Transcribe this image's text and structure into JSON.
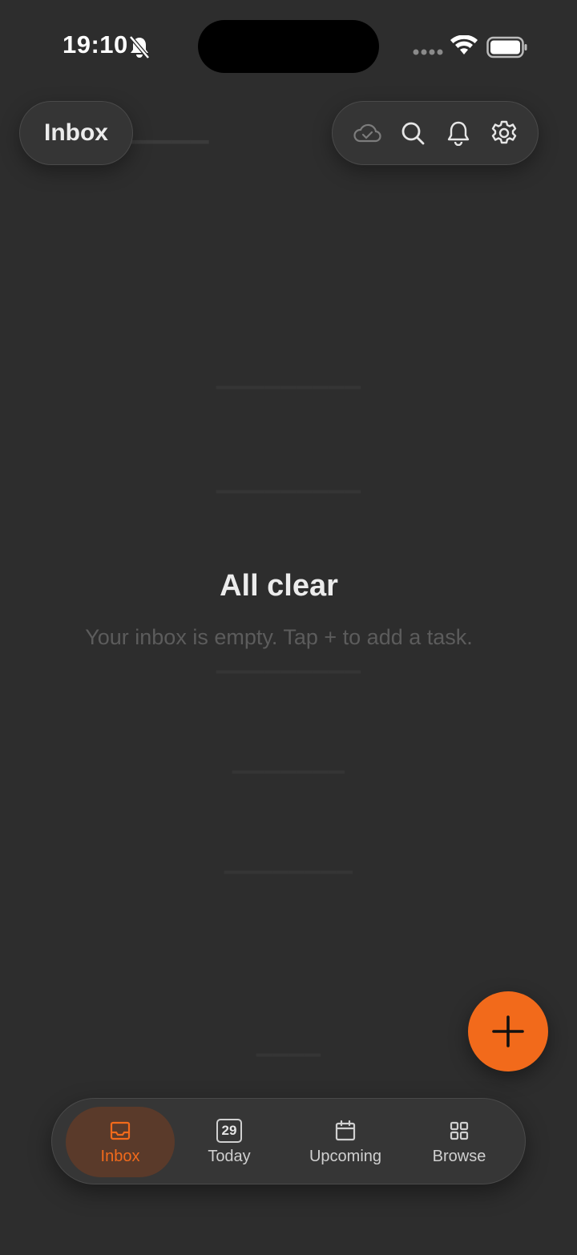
{
  "status_bar": {
    "time": "19:10",
    "icons": [
      "bell-slash-icon",
      "cellular-signal-icon",
      "wifi-icon",
      "battery-icon"
    ]
  },
  "header": {
    "title": "Inbox",
    "actions": [
      "cloud-sync-icon",
      "search-icon",
      "notifications-icon",
      "settings-icon"
    ]
  },
  "empty_state": {
    "title": "All clear",
    "subtitle": "Your inbox is empty. Tap + to add a task."
  },
  "fab": {
    "icon": "plus-icon",
    "color": "#f26a1b"
  },
  "tabbar": {
    "tabs": [
      {
        "label": "Inbox",
        "icon": "inbox-tray-icon",
        "active": true
      },
      {
        "label": "Today",
        "icon": "calendar-day-icon",
        "badge": "29",
        "active": false
      },
      {
        "label": "Upcoming",
        "icon": "calendar-icon",
        "active": false
      },
      {
        "label": "Browse",
        "icon": "grid-icon",
        "active": false
      }
    ]
  },
  "colors": {
    "background": "#2d2d2d",
    "accent": "#f26a1b",
    "active_tab_bg": "#5a3a2a"
  }
}
